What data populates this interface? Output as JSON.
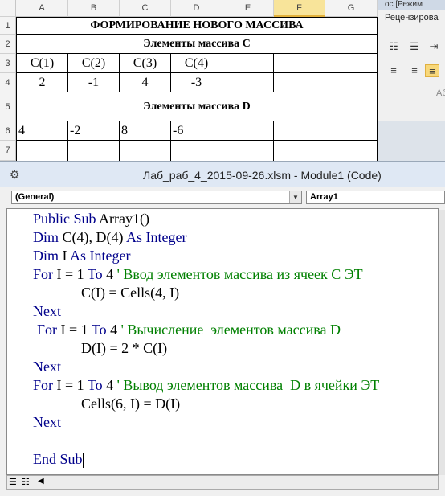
{
  "spreadsheet": {
    "columns": [
      "A",
      "B",
      "C",
      "D",
      "E",
      "F",
      "G"
    ],
    "rows": [
      "1",
      "2",
      "3",
      "4",
      "5",
      "6",
      "7"
    ],
    "title": "ФОРМИРОВАНИЕ НОВОГО МАССИВА",
    "section_c": "Элементы массива С",
    "headers_c": [
      "С(1)",
      "С(2)",
      "С(3)",
      "С(4)"
    ],
    "values_c": [
      "2",
      "-1",
      "4",
      "-3"
    ],
    "section_d": "Элементы массива  D",
    "values_d": [
      "4",
      "-2",
      "8",
      "-6"
    ]
  },
  "ribbon": {
    "top_text": "ос [Режим",
    "tab": "Рецензирова",
    "group_label": "Аб"
  },
  "vbe": {
    "title": "Лаб_раб_4_2015-09-26.xlsm - Module1 (Code)",
    "object_combo": "(General)",
    "proc_combo": "Array1",
    "lines": [
      {
        "kw1": "Public Sub ",
        "txt": "Array1()"
      },
      {
        "kw1": "Dim ",
        "txt": "C(4), D(4) ",
        "kw2": "As Integer"
      },
      {
        "kw1": "Dim ",
        "txt": "I ",
        "kw2": "As Integer"
      },
      {
        "kw1": "For ",
        "txt": "I = 1 ",
        "kw2": "To ",
        "txt2": "4 ",
        "cm": "' Ввод элементов массива из ячеек С ЭТ"
      },
      {
        "txt": "C(I) = Cells(4, I)"
      },
      {
        "kw1": "Next"
      },
      {
        "kw1": "For ",
        "txt": "I = 1 ",
        "kw2": "To ",
        "txt2": "4 ",
        "cm": "' Вычисление  элементов массива D"
      },
      {
        "txt": "D(I) = 2 * C(I)"
      },
      {
        "kw1": "Next"
      },
      {
        "kw1": "For ",
        "txt": "I = 1 ",
        "kw2": "To ",
        "txt2": "4 ",
        "cm": "' Вывод элементов массива  D в ячейки ЭТ"
      },
      {
        "txt": "Cells(6, I) = D(I)"
      },
      {
        "kw1": "Next"
      },
      {
        "txt": ""
      },
      {
        "kw1": "End Sub"
      }
    ]
  }
}
